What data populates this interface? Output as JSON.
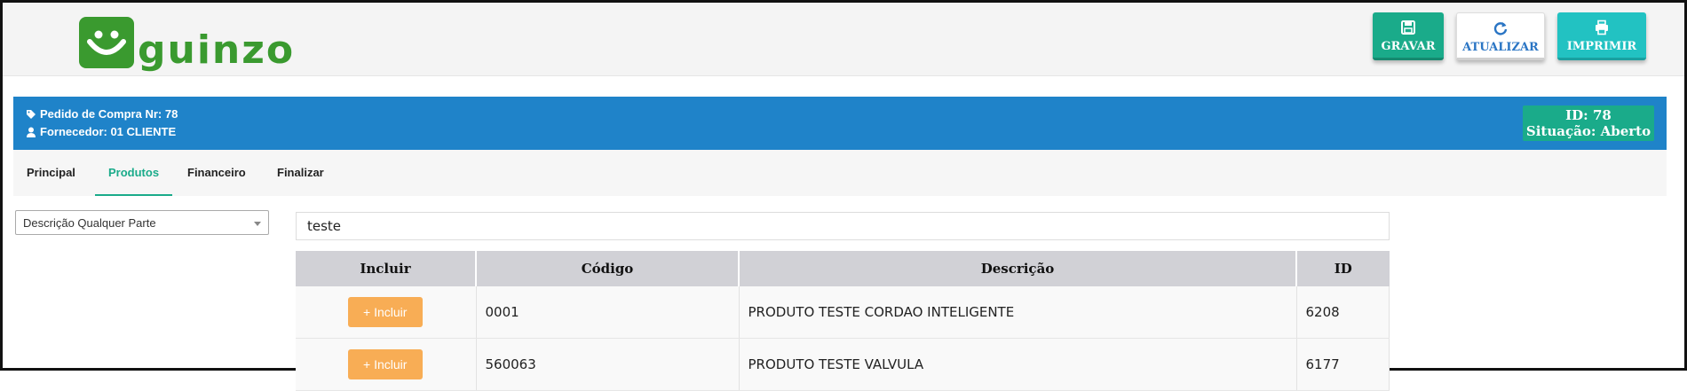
{
  "brand": {
    "name": "guinzo",
    "color": "#3a9a2f"
  },
  "toolbar": {
    "gravar_label": "GRAVAR",
    "atualizar_label": "ATUALIZAR",
    "imprimir_label": "IMPRIMIR",
    "gravar_icon": "save-icon",
    "atualizar_icon": "refresh-icon",
    "imprimir_icon": "print-icon"
  },
  "order": {
    "title": "Pedido de Compra Nr: 78",
    "supplier": "Fornecedor: 01 CLIENTE",
    "id_line": "ID: 78",
    "status_line": "Situação: Aberto"
  },
  "tabs": [
    {
      "label": "Principal"
    },
    {
      "label": "Produtos",
      "active": true
    },
    {
      "label": "Financeiro"
    },
    {
      "label": "Finalizar"
    }
  ],
  "filter": {
    "selected": "Descrição Qualquer Parte"
  },
  "search": {
    "value": "teste"
  },
  "table": {
    "headers": [
      "Incluir",
      "Código",
      "Descrição",
      "ID"
    ],
    "include_label": "+ Incluir",
    "rows": [
      {
        "codigo": "0001",
        "descricao": "PRODUTO TESTE CORDAO INTELIGENTE",
        "id": "6208"
      },
      {
        "codigo": "560063",
        "descricao": "PRODUTO TESTE VALVULA",
        "id": "6177"
      }
    ]
  },
  "colors": {
    "primary_blue": "#1f83c9",
    "teal": "#1aab8a",
    "orange": "#f8ad55",
    "cyan": "#22c2c2"
  }
}
